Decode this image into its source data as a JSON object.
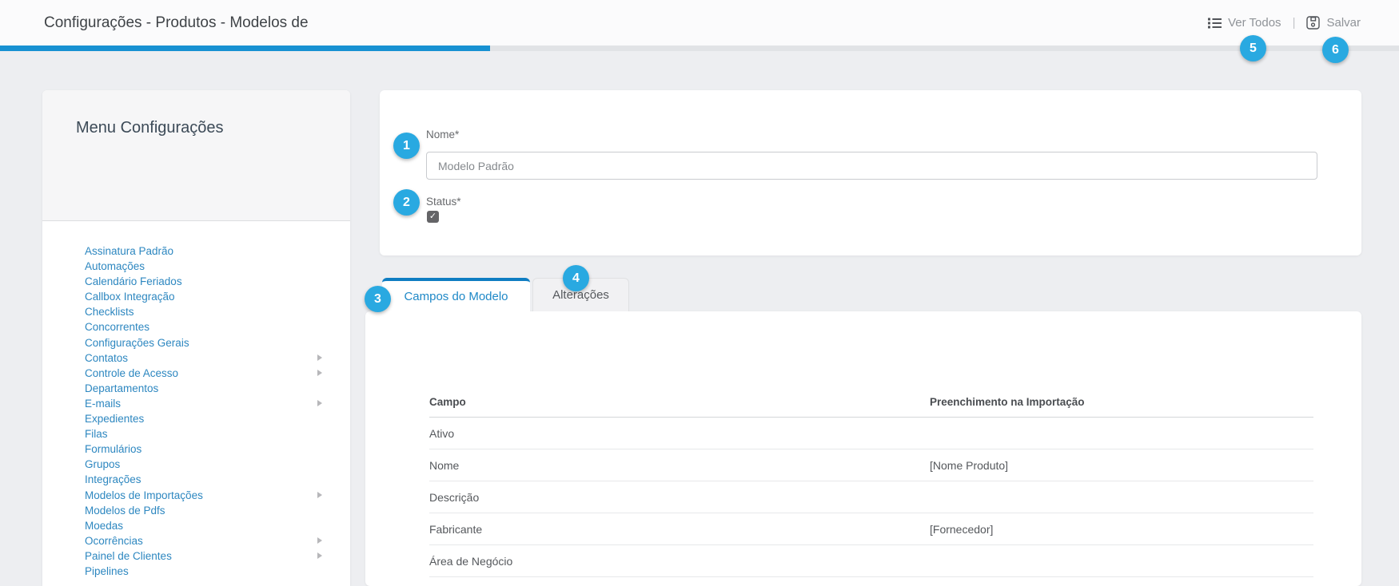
{
  "header": {
    "title": "Configurações - Produtos - Modelos de",
    "actions": {
      "ver_todos": "Ver Todos",
      "separator": "|",
      "salvar": "Salvar"
    }
  },
  "callouts": [
    "1",
    "2",
    "3",
    "4",
    "5",
    "6"
  ],
  "sidebar": {
    "title": "Menu Configurações",
    "items": [
      {
        "label": "Assinatura Padrão",
        "has_submenu": false
      },
      {
        "label": "Automações",
        "has_submenu": false
      },
      {
        "label": "Calendário Feriados",
        "has_submenu": false
      },
      {
        "label": "Callbox Integração",
        "has_submenu": false
      },
      {
        "label": "Checklists",
        "has_submenu": false
      },
      {
        "label": "Concorrentes",
        "has_submenu": false
      },
      {
        "label": "Configurações Gerais",
        "has_submenu": false
      },
      {
        "label": "Contatos",
        "has_submenu": true
      },
      {
        "label": "Controle de Acesso",
        "has_submenu": true
      },
      {
        "label": "Departamentos",
        "has_submenu": false
      },
      {
        "label": "E-mails",
        "has_submenu": true
      },
      {
        "label": "Expedientes",
        "has_submenu": false
      },
      {
        "label": "Filas",
        "has_submenu": false
      },
      {
        "label": "Formulários",
        "has_submenu": false
      },
      {
        "label": "Grupos",
        "has_submenu": false
      },
      {
        "label": "Integrações",
        "has_submenu": false
      },
      {
        "label": "Modelos de Importações",
        "has_submenu": true
      },
      {
        "label": "Modelos de Pdfs",
        "has_submenu": false
      },
      {
        "label": "Moedas",
        "has_submenu": false
      },
      {
        "label": "Ocorrências",
        "has_submenu": true
      },
      {
        "label": "Painel de Clientes",
        "has_submenu": true
      },
      {
        "label": "Pipelines",
        "has_submenu": false
      }
    ]
  },
  "form": {
    "nome_label": "Nome*",
    "nome_value": "Modelo Padrão",
    "status_label": "Status*",
    "status_checked": true
  },
  "tabs": [
    {
      "label": "Campos do Modelo",
      "active": true
    },
    {
      "label": "Alterações",
      "active": false
    }
  ],
  "table": {
    "columns": [
      "Campo",
      "Preenchimento na Importação"
    ],
    "rows": [
      {
        "campo": "Ativo",
        "preenchimento": ""
      },
      {
        "campo": "Nome",
        "preenchimento": "[Nome Produto]"
      },
      {
        "campo": "Descrição",
        "preenchimento": ""
      },
      {
        "campo": "Fabricante",
        "preenchimento": "[Fornecedor]"
      },
      {
        "campo": "Área de Negócio",
        "preenchimento": ""
      }
    ]
  },
  "colors": {
    "accent_blue": "#29a9e1",
    "progress_blue": "#1791d2",
    "tab_active_blue": "#1e88c7",
    "link_blue": "#2d87c0",
    "page_background": "#edeef1"
  }
}
